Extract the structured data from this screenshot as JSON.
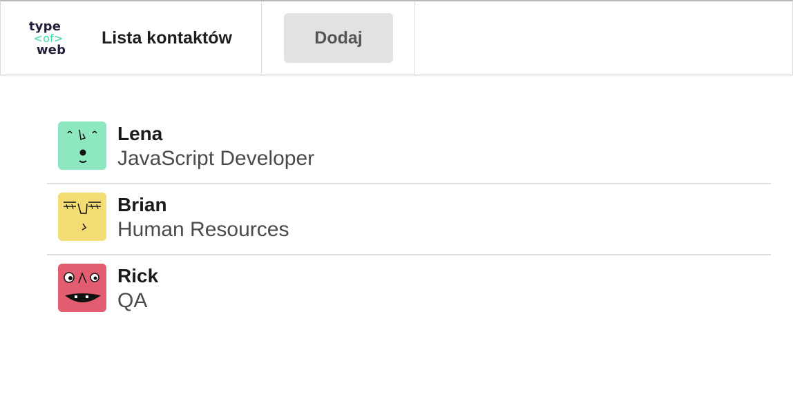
{
  "header": {
    "logo": {
      "line1": "type",
      "line2": "<of>",
      "line3": "web"
    },
    "title": "Lista kontaktów",
    "add_button_label": "Dodaj"
  },
  "contacts": [
    {
      "name": "Lena",
      "department": "JavaScript Developer",
      "avatar_color": "#8de8c2",
      "avatar_icon": "face-avatar-icon"
    },
    {
      "name": "Brian",
      "department": "Human Resources",
      "avatar_color": "#f2dc73",
      "avatar_icon": "face-avatar-icon"
    },
    {
      "name": "Rick",
      "department": "QA",
      "avatar_color": "#e15d6f",
      "avatar_icon": "face-avatar-icon"
    }
  ],
  "colors": {
    "logo_dark": "#1f1f3a",
    "logo_accent": "#34d9a8",
    "button_bg": "#e1e2e4"
  }
}
